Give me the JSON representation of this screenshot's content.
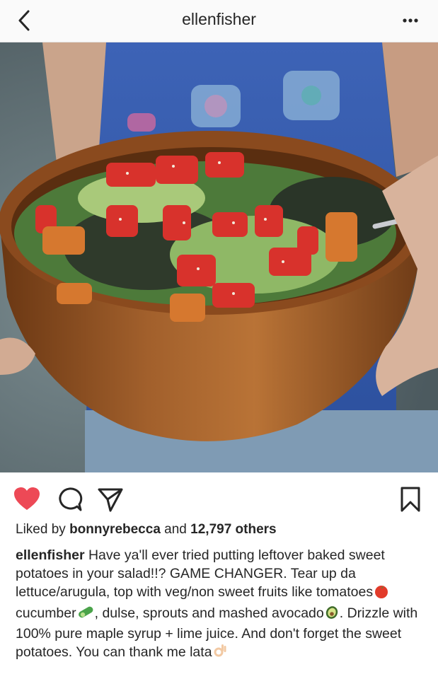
{
  "header": {
    "title": "ellenfisher",
    "back_icon": "chevron-left-icon",
    "more_icon": "more-horizontal-icon"
  },
  "post": {
    "image_desc_icon": "salad-photo",
    "actions": {
      "like_icon": "heart-filled-icon",
      "comment_icon": "comment-icon",
      "share_icon": "send-icon",
      "save_icon": "bookmark-icon",
      "like_color": "#ed4956"
    },
    "likes": {
      "prefix": "Liked by",
      "user": "bonnyrebecca",
      "joiner": "and",
      "count": "12,797 others"
    },
    "caption": {
      "username": "ellenfisher",
      "part1": "Have ya'll ever tried putting leftover baked sweet potatoes in your salad!!? GAME CHANGER. Tear up da lettuce/arugula, top with veg/non sweet fruits like tomatoes",
      "part2": " cucumber",
      "part3": ", dulse, sprouts and mashed avocado",
      "part4": ". Drizzle with 100% pure maple syrup + lime juice. And don't forget the sweet potatoes. You can thank me lata"
    }
  }
}
